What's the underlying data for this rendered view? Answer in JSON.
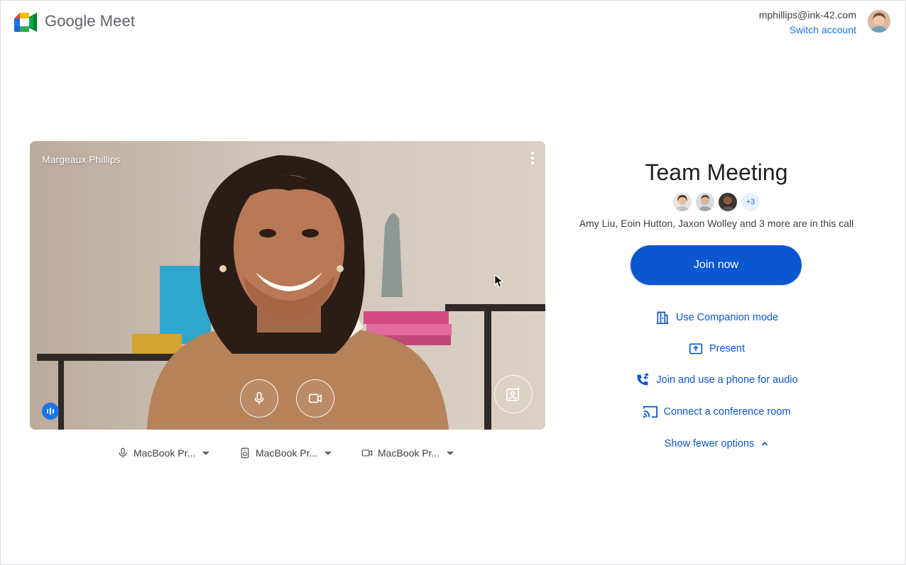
{
  "app": {
    "name": "Google Meet"
  },
  "account": {
    "email": "mphillips@ink-42.com",
    "switch_label": "Switch account"
  },
  "preview": {
    "self_name": "Margeaux Phillips"
  },
  "devices": [
    {
      "label": "MacBook Pr...",
      "icon": "microphone-icon"
    },
    {
      "label": "MacBook Pr...",
      "icon": "speaker-icon"
    },
    {
      "label": "MacBook Pr...",
      "icon": "camera-icon"
    }
  ],
  "meeting": {
    "title": "Team Meeting",
    "more_count": "+3",
    "in_call_text": "Amy Liu, Eoin Hutton, Jaxon Wolley and 3 more are in this call",
    "join_label": "Join now"
  },
  "options": [
    {
      "label": "Use Companion mode",
      "icon": "companion-mode-icon"
    },
    {
      "label": "Present",
      "icon": "present-icon"
    },
    {
      "label": "Join and use a phone for audio",
      "icon": "phone-audio-icon"
    },
    {
      "label": "Connect a conference room",
      "icon": "cast-icon"
    }
  ],
  "show_fewer_label": "Show fewer options",
  "colors": {
    "primary_button": "#0b57d0",
    "link": "#1a73e8",
    "text": "#202124"
  }
}
